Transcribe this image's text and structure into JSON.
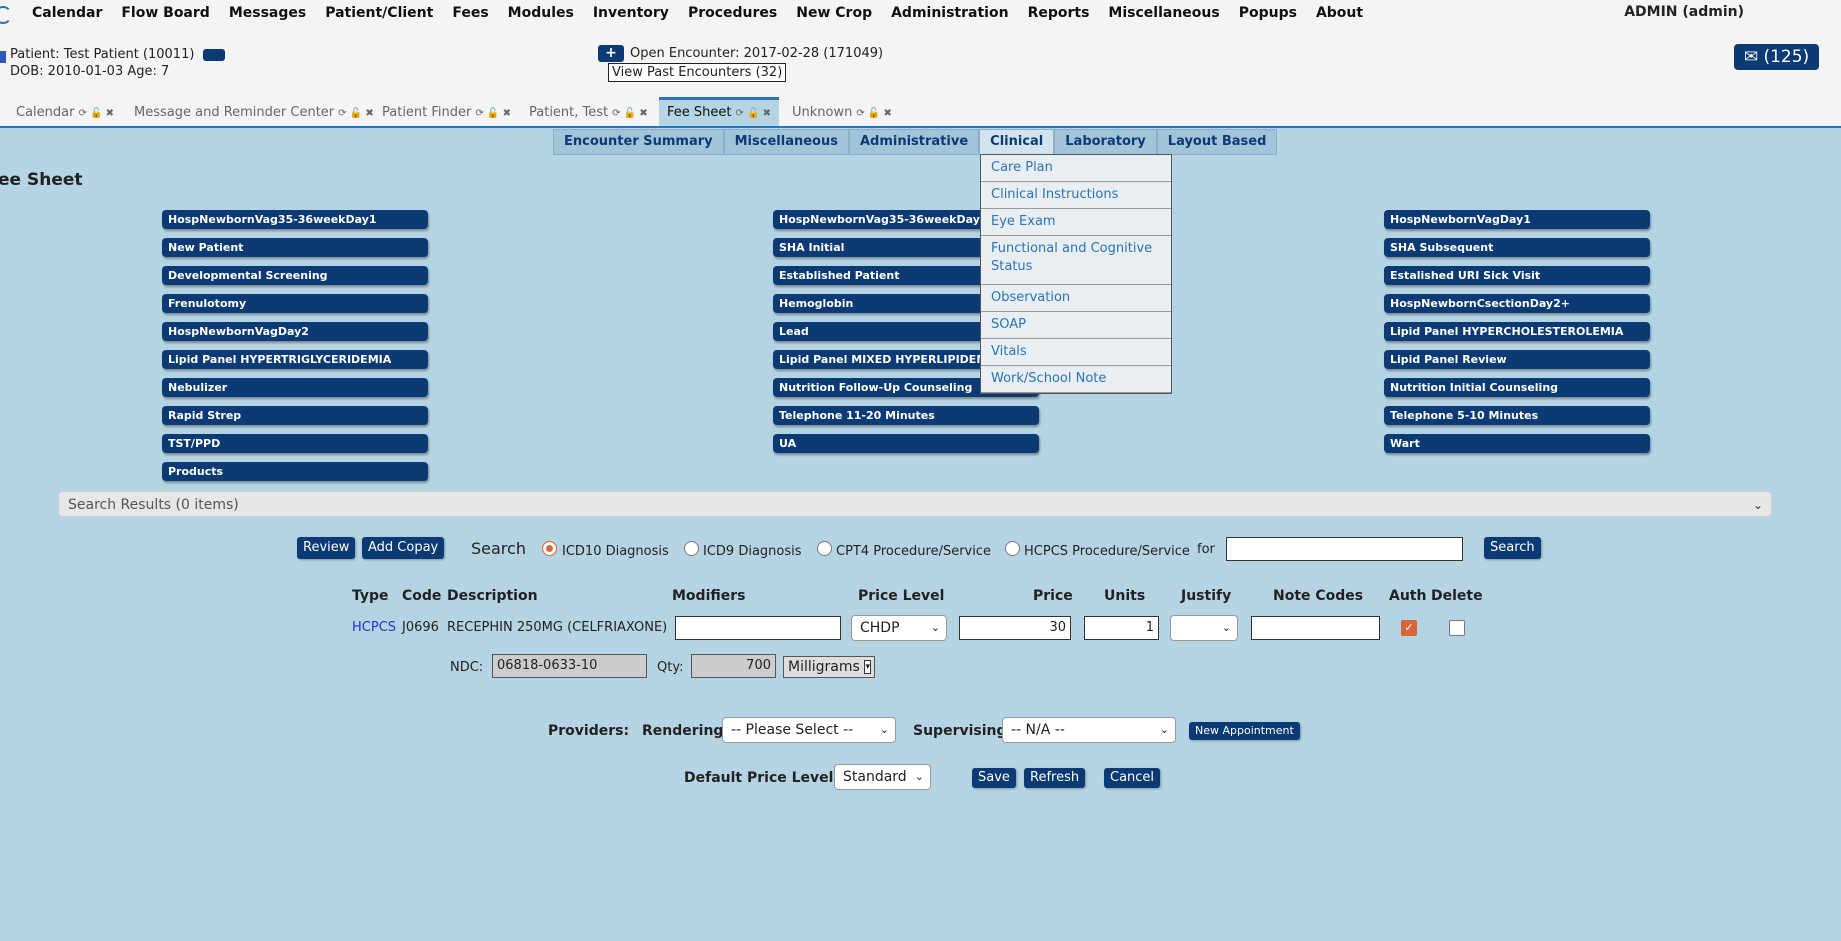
{
  "menu": [
    "Calendar",
    "Flow Board",
    "Messages",
    "Patient/Client",
    "Fees",
    "Modules",
    "Inventory",
    "Procedures",
    "New Crop",
    "Administration",
    "Reports",
    "Miscellaneous",
    "Popups",
    "About"
  ],
  "user": "ADMIN (admin)",
  "patient": {
    "label": "Patient:",
    "name": "Test Patient (10011)",
    "dob_line": "DOB: 2010-01-03 Age: 7"
  },
  "encounter": {
    "plus": "+",
    "label": "Open Encounter:",
    "value": "2017-02-28 (171049)",
    "past": "View Past Encounters (32)"
  },
  "messages_badge": "✉ (125)",
  "tabs": [
    "Calendar",
    "Message and Reminder Center",
    "Patient Finder",
    "Patient, Test",
    "Fee Sheet",
    "Unknown"
  ],
  "tab_controls": "⟳ 🔓 ✖",
  "subnav": [
    "Encounter Summary",
    "Miscellaneous",
    "Administrative",
    "Clinical",
    "Laboratory",
    "Layout Based"
  ],
  "clinical_menu": [
    "Care Plan",
    "Clinical Instructions",
    "Eye Exam",
    "Functional and Cognitive Status",
    "Observation",
    "SOAP",
    "Vitals",
    "Work/School Note"
  ],
  "title": "ee Sheet",
  "col1": [
    "HospNewbornVag35-36weekDay1",
    "New Patient",
    "Developmental Screening",
    "Frenulotomy",
    "HospNewbornVagDay2",
    "Lipid Panel HYPERTRIGLYCERIDEMIA",
    "Nebulizer",
    "Rapid Strep",
    "TST/PPD",
    "Products"
  ],
  "col2": [
    "HospNewbornVag35-36weekDay2",
    "SHA Initial",
    "Established Patient",
    "Hemoglobin",
    "Lead",
    "Lipid Panel MIXED HYPERLIPIDEMIA",
    "Nutrition Follow-Up Counseling",
    "Telephone 11-20 Minutes",
    "UA"
  ],
  "col3": [
    "HospNewbornVagDay1",
    "SHA Subsequent",
    "Estalished URI Sick Visit",
    "HospNewbornCsectionDay2+",
    "Lipid Panel HYPERCHOLESTEROLEMIA",
    "Lipid Panel Review",
    "Nutrition Initial Counseling",
    "Telephone 5-10 Minutes",
    "Wart"
  ],
  "search_results": "Search Results (0 items)",
  "search": {
    "review": "Review",
    "add_copay": "Add Copay",
    "label": "Search",
    "opt1": "ICD10 Diagnosis",
    "opt2": "ICD9 Diagnosis",
    "opt3": "CPT4 Procedure/Service",
    "opt4": "HCPCS Procedure/Service",
    "for": "for",
    "button": "Search",
    "query": ""
  },
  "columns": {
    "type": "Type",
    "code": "Code",
    "desc": "Description",
    "mods": "Modifiers",
    "price_level": "Price Level",
    "price": "Price",
    "units": "Units",
    "justify": "Justify",
    "note": "Note Codes",
    "auth": "Auth",
    "delete": "Delete"
  },
  "row": {
    "type": "HCPCS",
    "code": "J0696",
    "desc": "RECEPHIN 250MG (CELFRIAXONE)",
    "mods": "",
    "price_level": "CHDP",
    "price": "30",
    "units": "1",
    "justify": "",
    "note": "",
    "auth": true,
    "delete": false
  },
  "ndc": {
    "label": "NDC:",
    "value": "06818-0633-10",
    "qty_label": "Qty:",
    "qty": "700",
    "unit": "Milligrams"
  },
  "providers": {
    "label": "Providers:",
    "rendering_label": "Rendering",
    "rendering": "-- Please Select --",
    "supervising_label": "Supervising",
    "supervising": "-- N/A --",
    "new_appt": "New Appointment"
  },
  "footer": {
    "label": "Default Price Level:",
    "level": "Standard",
    "save": "Save",
    "refresh": "Refresh",
    "cancel": "Cancel"
  }
}
